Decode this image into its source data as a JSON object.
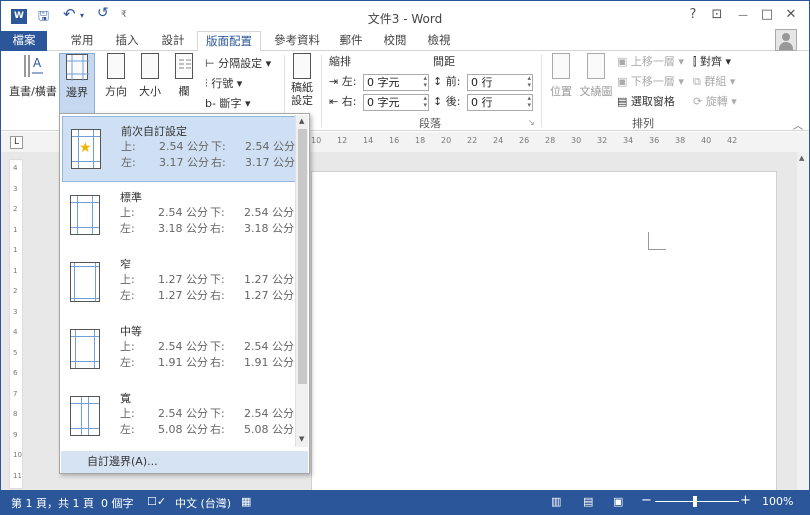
{
  "titlebar": {
    "app_icon": "W",
    "save": "🖫",
    "undo": "↶",
    "undo_dd": "▾",
    "redo": "↺",
    "qat_more": "₹",
    "title": "文件3 - Word",
    "help": "?",
    "ribbon_display": "⊡",
    "minimize": "—",
    "restore": "□",
    "close": "✕"
  },
  "tabs": [
    "檔案",
    "常用",
    "插入",
    "設計",
    "版面配置",
    "參考資料",
    "郵件",
    "校閱",
    "檢視"
  ],
  "ribbon": {
    "text_direction": "直書/橫書",
    "margins": "邊界",
    "orientation": "方向",
    "size": "大小",
    "columns": "欄",
    "breaks": "分隔設定",
    "line_numbers": "行號",
    "hyphenation": "斷字",
    "draft": [
      "稿紙",
      "設定"
    ],
    "indent_title": "縮排",
    "spacing_title": "間距",
    "indent_left_label": "左:",
    "indent_left_value": "0 字元",
    "indent_right_label": "右:",
    "indent_right_value": "0 字元",
    "spacing_before_label": "前:",
    "spacing_before_value": "0 行",
    "spacing_after_label": "後:",
    "spacing_after_value": "0 行",
    "paragraph_group": "段落",
    "position": "位置",
    "wrap_text": "文繞圖",
    "bring_forward": "上移一層",
    "send_backward": "下移一層",
    "selection_pane": "選取窗格",
    "align": "對齊",
    "group": "群組",
    "rotate": "旋轉",
    "arrange_group": "排列"
  },
  "ruler": {
    "tab_selector": "L",
    "h_marks": [
      "10",
      "12",
      "14",
      "16",
      "18",
      "20",
      "22",
      "24",
      "26",
      "28",
      "30",
      "32",
      "34",
      "36",
      "38",
      "40",
      "42"
    ],
    "v_marks": [
      "4",
      "3",
      "2",
      "1",
      "1",
      "1",
      "2",
      "3",
      "4",
      "5",
      "6",
      "7",
      "8",
      "9",
      "10",
      "11"
    ]
  },
  "margins_menu": {
    "items": [
      {
        "name": "前次自訂設定",
        "top_label": "上:",
        "top": "2.54 公分",
        "bottom_label": "下:",
        "bottom": "2.54 公分",
        "left_label": "左:",
        "left": "3.17 公分",
        "right_label": "右:",
        "right": "3.17 公分"
      },
      {
        "name": "標準",
        "top_label": "上:",
        "top": "2.54 公分",
        "bottom_label": "下:",
        "bottom": "2.54 公分",
        "left_label": "左:",
        "left": "3.18 公分",
        "right_label": "右:",
        "right": "3.18 公分"
      },
      {
        "name": "窄",
        "top_label": "上:",
        "top": "1.27 公分",
        "bottom_label": "下:",
        "bottom": "1.27 公分",
        "left_label": "左:",
        "left": "1.27 公分",
        "right_label": "右:",
        "right": "1.27 公分"
      },
      {
        "name": "中等",
        "top_label": "上:",
        "top": "2.54 公分",
        "bottom_label": "下:",
        "bottom": "2.54 公分",
        "left_label": "左:",
        "left": "1.91 公分",
        "right_label": "右:",
        "right": "1.91 公分"
      },
      {
        "name": "寬",
        "top_label": "上:",
        "top": "2.54 公分",
        "bottom_label": "下:",
        "bottom": "2.54 公分",
        "left_label": "左:",
        "left": "5.08 公分",
        "right_label": "右:",
        "right": "5.08 公分"
      }
    ],
    "custom": "自訂邊界(A)..."
  },
  "statusbar": {
    "page": "第 1 頁，共 1 頁",
    "words": "0 個字",
    "language": "中文 (台灣)",
    "zoom": "100%",
    "zoom_minus": "−",
    "zoom_plus": "+"
  },
  "colors": {
    "accent": "#2b579a",
    "selected": "#cfe0f4"
  }
}
